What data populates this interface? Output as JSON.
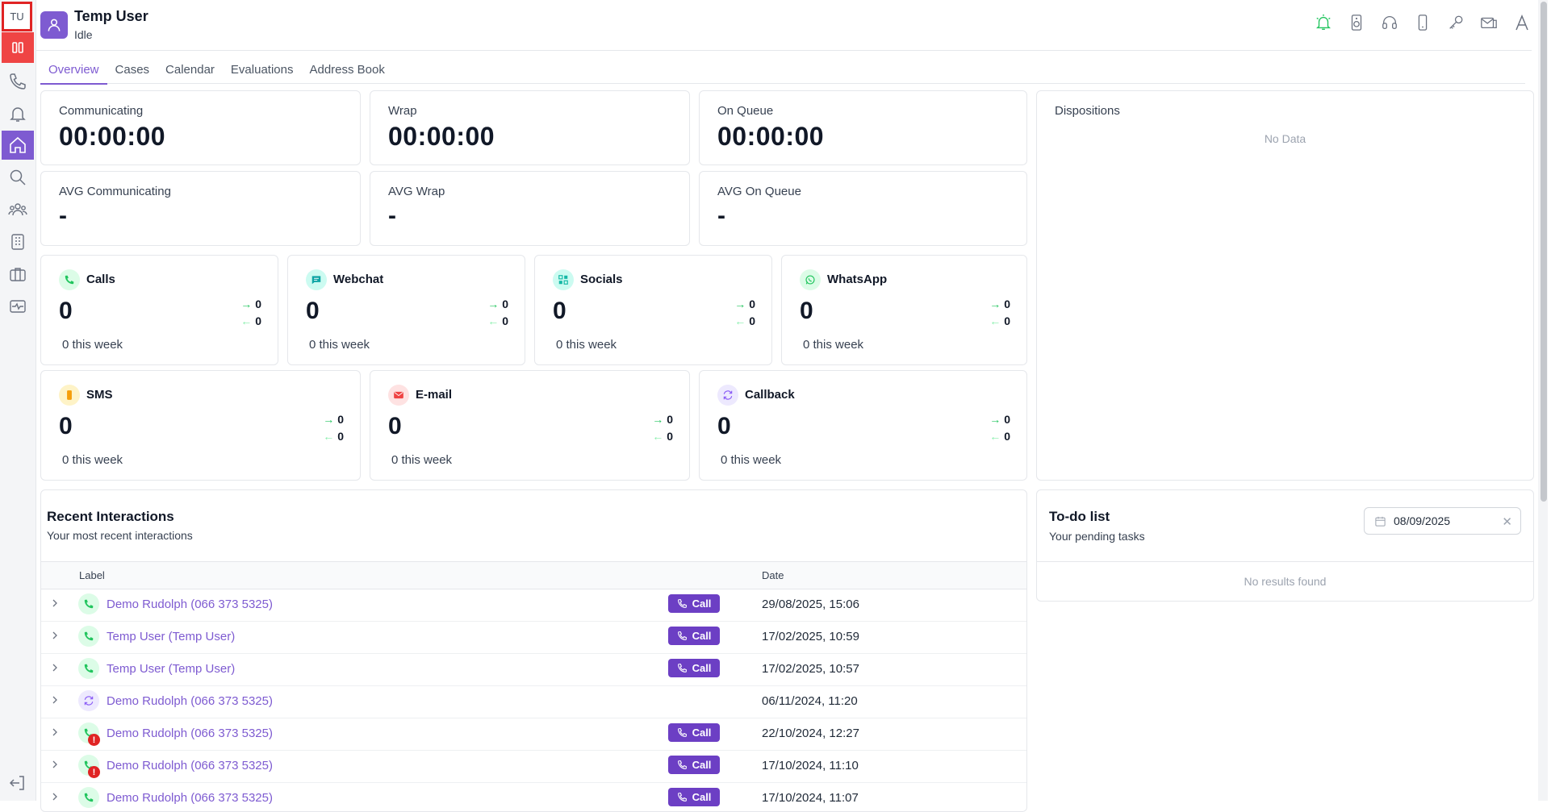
{
  "sidebar": {
    "avatar_initials": "TU",
    "items": [
      {
        "icon": "status-pause-icon"
      },
      {
        "icon": "phone-icon"
      },
      {
        "icon": "bell-icon"
      },
      {
        "icon": "home-icon",
        "active": true
      },
      {
        "icon": "search-icon"
      },
      {
        "icon": "users-icon"
      },
      {
        "icon": "building-icon"
      },
      {
        "icon": "briefcase-icon"
      },
      {
        "icon": "activity-icon"
      }
    ],
    "logout_icon": "logout-icon"
  },
  "header": {
    "user_name": "Temp User",
    "user_status": "Idle",
    "tools": [
      "alert-bell-icon",
      "speaker-icon",
      "headset-icon",
      "mobile-icon",
      "key-icon",
      "mail-inbox-icon",
      "font-icon"
    ]
  },
  "tabs": [
    {
      "label": "Overview",
      "active": true
    },
    {
      "label": "Cases"
    },
    {
      "label": "Calendar"
    },
    {
      "label": "Evaluations"
    },
    {
      "label": "Address Book"
    }
  ],
  "stats": {
    "communicating": {
      "label": "Communicating",
      "value": "00:00:00"
    },
    "wrap": {
      "label": "Wrap",
      "value": "00:00:00"
    },
    "on_queue": {
      "label": "On Queue",
      "value": "00:00:00"
    },
    "avg_communicating": {
      "label": "AVG Communicating",
      "value": "-"
    },
    "avg_wrap": {
      "label": "AVG Wrap",
      "value": "-"
    },
    "avg_on_queue": {
      "label": "AVG On Queue",
      "value": "-"
    }
  },
  "channels": {
    "calls": {
      "name": "Calls",
      "count": "0",
      "in": "0",
      "out": "0",
      "week": "0 this week",
      "color": "#22c55e"
    },
    "webchat": {
      "name": "Webchat",
      "count": "0",
      "in": "0",
      "out": "0",
      "week": "0 this week",
      "color": "#0ea5a5"
    },
    "socials": {
      "name": "Socials",
      "count": "0",
      "in": "0",
      "out": "0",
      "week": "0 this week",
      "color": "#14b8a6"
    },
    "whatsapp": {
      "name": "WhatsApp",
      "count": "0",
      "in": "0",
      "out": "0",
      "week": "0 this week",
      "color": "#22c55e"
    },
    "sms": {
      "name": "SMS",
      "count": "0",
      "in": "0",
      "out": "0",
      "week": "0 this week",
      "color": "#f59e0b"
    },
    "email": {
      "name": "E-mail",
      "count": "0",
      "in": "0",
      "out": "0",
      "week": "0 this week",
      "color": "#ef4444"
    },
    "callback": {
      "name": "Callback",
      "count": "0",
      "in": "0",
      "out": "0",
      "week": "0 this week",
      "color": "#8b5cf6"
    }
  },
  "dispositions": {
    "title": "Dispositions",
    "empty": "No Data"
  },
  "recent": {
    "title": "Recent Interactions",
    "subtitle": "Your most recent interactions",
    "col_label": "Label",
    "col_date": "Date",
    "rows": [
      {
        "label": "Demo Rudolph (066 373 5325)",
        "button": "Call",
        "date": "29/08/2025, 15:06"
      },
      {
        "label": "Temp User (Temp User)",
        "button": "Call",
        "date": "17/02/2025, 10:59"
      },
      {
        "label": "Temp User (Temp User)",
        "button": "Call",
        "date": "17/02/2025, 10:57"
      },
      {
        "label": "Demo Rudolph (066 373 5325)",
        "button": "",
        "date": "06/11/2024, 11:20"
      },
      {
        "label": "Demo Rudolph (066 373 5325)",
        "button": "Call",
        "date": "22/10/2024, 12:27"
      },
      {
        "label": "Demo Rudolph (066 373 5325)",
        "button": "Call",
        "date": "17/10/2024, 11:10"
      },
      {
        "label": "Demo Rudolph (066 373 5325)",
        "button": "Call",
        "date": "17/10/2024, 11:07"
      }
    ]
  },
  "todo": {
    "title": "To-do list",
    "subtitle": "Your pending tasks",
    "date": "08/09/2025",
    "clear": "✕",
    "empty": "No results found"
  }
}
